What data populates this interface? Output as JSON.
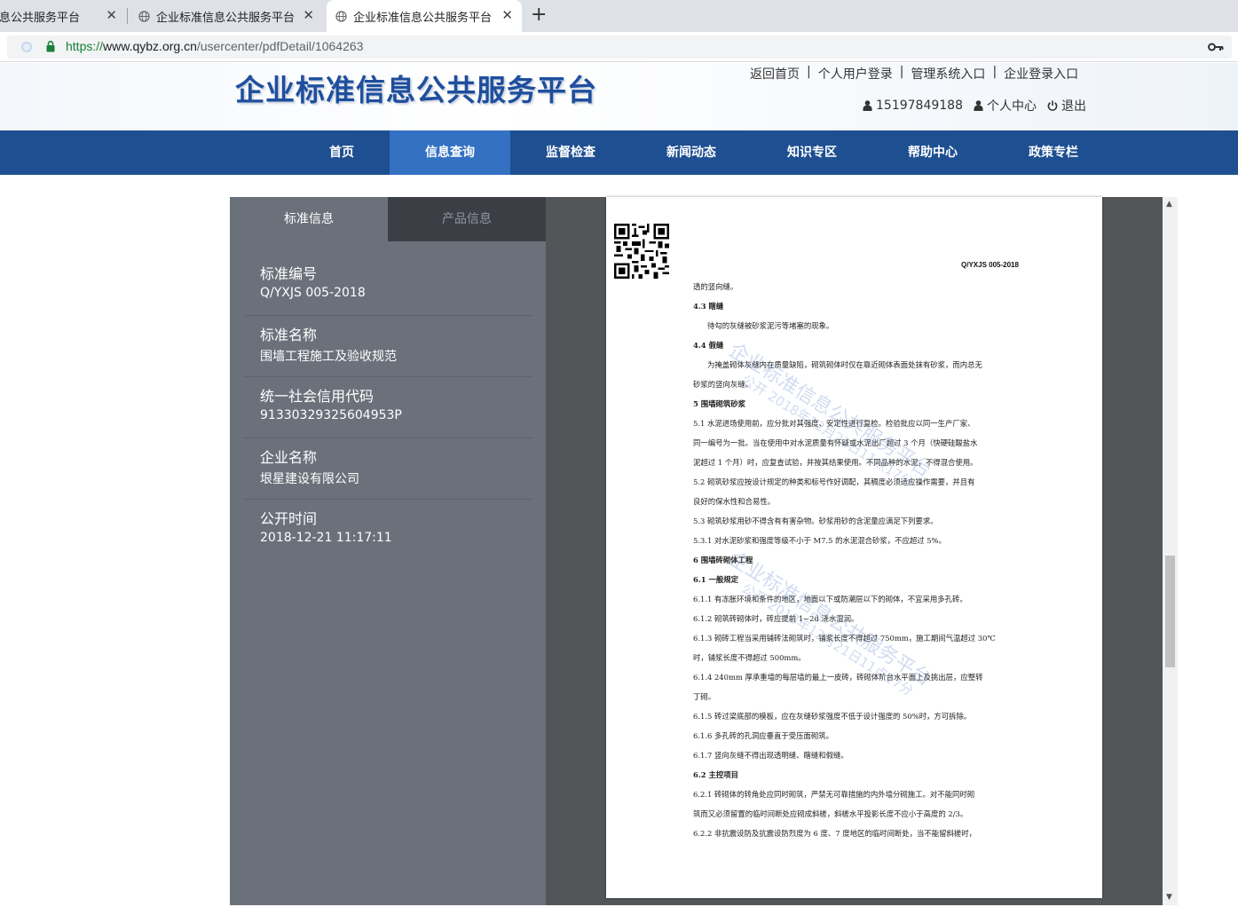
{
  "browser": {
    "tabs": [
      {
        "title": "企业标准信息公共服务平台",
        "close": "✕"
      },
      {
        "title": "企业标准信息公共服务平台",
        "close": "✕"
      },
      {
        "title": "企业标准信息公共服务平台",
        "close": "✕"
      }
    ],
    "tab1_visible_title": "信息公共服务平台",
    "new_tab": "+",
    "url_scheme": "https://",
    "url_host": "www.qybz.org.cn",
    "url_path": "/usercenter/pdfDetail/1064263"
  },
  "header": {
    "logo": "企业标准信息公共服务平台",
    "links": [
      "返回首页",
      "个人用户登录",
      "管理系统入口",
      "企业登录入口"
    ],
    "separator": "|",
    "phone": "15197849188",
    "personal_center": "个人中心",
    "logout": "退出"
  },
  "nav": {
    "items": [
      "首页",
      "信息查询",
      "监督检查",
      "新闻动态",
      "知识专区",
      "帮助中心",
      "政策专栏"
    ],
    "active": "信息查询"
  },
  "panel": {
    "tabs": [
      "标准信息",
      "产品信息"
    ],
    "items": [
      {
        "label": "标准编号",
        "value": "Q/YXJS 005-2018"
      },
      {
        "label": "标准名称",
        "value": "围墙工程施工及验收规范"
      },
      {
        "label": "统一社会信用代码",
        "value": "91330329325604953P"
      },
      {
        "label": "企业名称",
        "value": "垠星建设有限公司"
      },
      {
        "label": "公开时间",
        "value": "2018-12-21 11:17:11"
      }
    ]
  },
  "document": {
    "code": "Q/YXJS 005-2018",
    "lines": [
      {
        "t": "透的竖向缝。",
        "s": ""
      },
      {
        "t": "4.3  瞎缝",
        "s": "h"
      },
      {
        "t": "待勾的灰缝被砂浆泥污等堵塞的现象。",
        "s": "ind"
      },
      {
        "t": "4.4  假缝",
        "s": "h"
      },
      {
        "t": "为掩盖砌体灰缝内在质量缺陷，砌筑砌体时仅在靠近砌体表面处抹有砂浆，而内总无",
        "s": "ind"
      },
      {
        "t": "砂浆的竖向灰缝。",
        "s": ""
      },
      {
        "t": "5  围墙砌筑砂浆",
        "s": "h"
      },
      {
        "t": "5.1  水泥进场使用前，应分批对其强度、安定性进行复检。检验批应以同一生产厂家、",
        "s": ""
      },
      {
        "t": "同一编号为一批。当在使用中对水泥质量有怀疑或水泥出厂超过 3 个月（快硬硅酸盐水",
        "s": ""
      },
      {
        "t": "泥超过 1 个月）时，应复查试验，并按其结果使用。不同品种的水泥，不得混合使用。",
        "s": ""
      },
      {
        "t": "5.2  砌筑砂浆应按设计规定的种类和标号作好调配，其稠度必须适应操作需要，并且有",
        "s": ""
      },
      {
        "t": "良好的保水性和合易性。",
        "s": ""
      },
      {
        "t": "5.3  砌筑砂浆用砂不得含有有害杂物。砂浆用砂的含泥量应满足下列要求。",
        "s": ""
      },
      {
        "t": "5.3.1  对水泥砂浆和强度等级不小于 M7.5 的水泥混合砂浆，不应超过 5%。",
        "s": ""
      },
      {
        "t": "6  围墙砖砌体工程",
        "s": "h"
      },
      {
        "t": "6.1  一般规定",
        "s": "h"
      },
      {
        "t": "6.1.1  有冻胀环境和条件的地区，地面以下或防潮层以下的砌体，不宜采用多孔砖。",
        "s": ""
      },
      {
        "t": "6.1.2  砌筑砖砌体时，砖应提前 1~2d 浇水湿润。",
        "s": ""
      },
      {
        "t": "6.1.3  砌砖工程当采用铺砖法砌筑时，铺浆长度不得超过 750mm，施工期间气温超过 30℃",
        "s": ""
      },
      {
        "t": "时，铺浆长度不得超过 500mm。",
        "s": ""
      },
      {
        "t": "6.1.4  240mm 厚承重墙的每层墙的最上一皮砖，砖砌体阶台水平面上及挑出层，应整转",
        "s": ""
      },
      {
        "t": "丁砌。",
        "s": ""
      },
      {
        "t": "6.1.5  砖过梁底部的模板，应在灰缝砂浆强度不低于设计强度的 50%时，方可拆除。",
        "s": ""
      },
      {
        "t": "6.1.6  多孔砖的孔洞应垂直于受压面砌筑。",
        "s": ""
      },
      {
        "t": "6.1.7  竖向灰缝不得出现透明缝、瞎缝和假缝。",
        "s": ""
      },
      {
        "t": "6.2  主控项目",
        "s": "h"
      },
      {
        "t": "6.2.1  砖砌体的转角处应同时砌筑，严禁无可靠措施的内外墙分砌施工。对不能同时砌",
        "s": ""
      },
      {
        "t": "筑而又必须留置的临时间断处应砌成斜槎，斜槎水平投影长度不应小于高度的 2/3。",
        "s": ""
      },
      {
        "t": "6.2.2  非抗震设防及抗震设防烈度为 6 度、7 度地区的临时间断处，当不能留斜槎时，",
        "s": ""
      }
    ],
    "watermark_main": "企业标准信息公共服务平台",
    "watermark_sub": "公开 2018年12月21日11点17分"
  },
  "colors": {
    "nav_bg": "#1e4f91",
    "nav_active": "#3471c3",
    "panel_bg": "#6b717b",
    "viewer_bg": "#525659",
    "logo": "#1f4e9c"
  }
}
